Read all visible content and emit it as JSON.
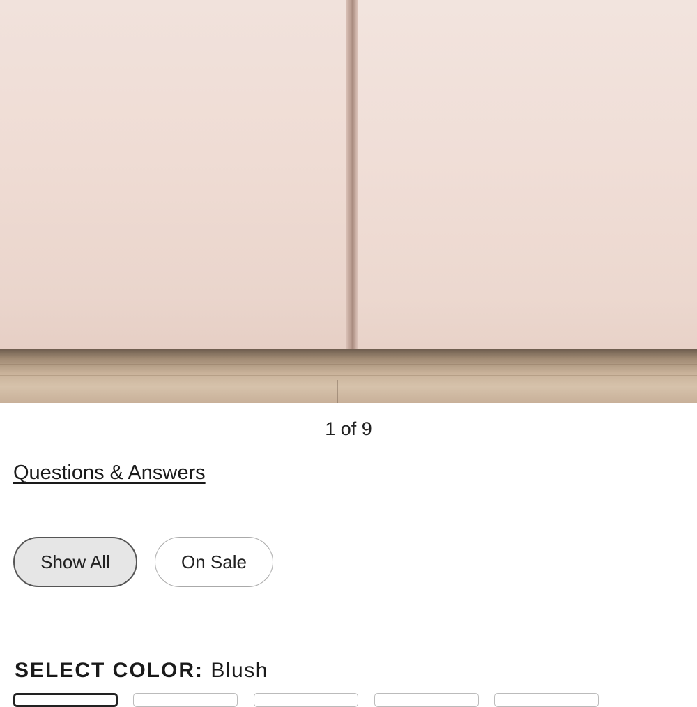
{
  "gallery": {
    "counter": "1 of 9",
    "image_icon": "product-photo-bedskirt"
  },
  "links": {
    "questions_answers": "Questions & Answers"
  },
  "filters": {
    "show_all": "Show All",
    "on_sale": "On Sale",
    "active": "Show All"
  },
  "color_selector": {
    "label": "SELECT COLOR:",
    "value": "Blush",
    "swatch_count_visible": 5,
    "selected_index": 0
  },
  "colors": {
    "selected_fill": "#e6e6e6",
    "text": "#1a1a1a"
  }
}
